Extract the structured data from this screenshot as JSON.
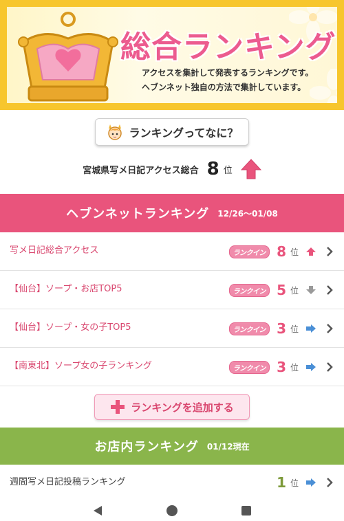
{
  "banner": {
    "title": "総合ランキング",
    "description_line1": "アクセスを集計して発表するランキングです。",
    "description_line2": "ヘブンネット独自の方法で集計しています。"
  },
  "what_is_button": {
    "label": "ランキングってなに？",
    "icon": "mascot-icon"
  },
  "overall": {
    "label": "宮城県写メ日記アクセス総合",
    "rank": "8",
    "unit": "位",
    "trend": "up"
  },
  "heaven_section": {
    "title": "ヘブンネットランキング",
    "period": "12/26〜01/08"
  },
  "rankings": [
    {
      "name": "写メ日記総合アクセス",
      "badge": "ランクイン",
      "rank": "8",
      "unit": "位",
      "trend": "up"
    },
    {
      "name": "【仙台】ソープ・お店TOP5",
      "badge": "ランクイン",
      "rank": "5",
      "unit": "位",
      "trend": "down"
    },
    {
      "name": "【仙台】ソープ・女の子TOP5",
      "badge": "ランクイン",
      "rank": "3",
      "unit": "位",
      "trend": "same"
    },
    {
      "name": "【南東北】ソープ女の子ランキング",
      "badge": "ランクイン",
      "rank": "3",
      "unit": "位",
      "trend": "same"
    }
  ],
  "add_button": {
    "label": "ランキングを追加する"
  },
  "shop_section": {
    "title": "お店内ランキング",
    "date": "01/12現在"
  },
  "shop_rankings": [
    {
      "name": "週間写メ日記投稿ランキング",
      "rank": "1",
      "unit": "位",
      "trend": "same"
    }
  ],
  "colors": {
    "pink": "#e9547c",
    "green": "#8ab54b",
    "banner_yellow": "#f7c62d",
    "trend_up": "#e9547c",
    "trend_down": "#9a9a9a",
    "trend_same": "#4a8fd6"
  }
}
